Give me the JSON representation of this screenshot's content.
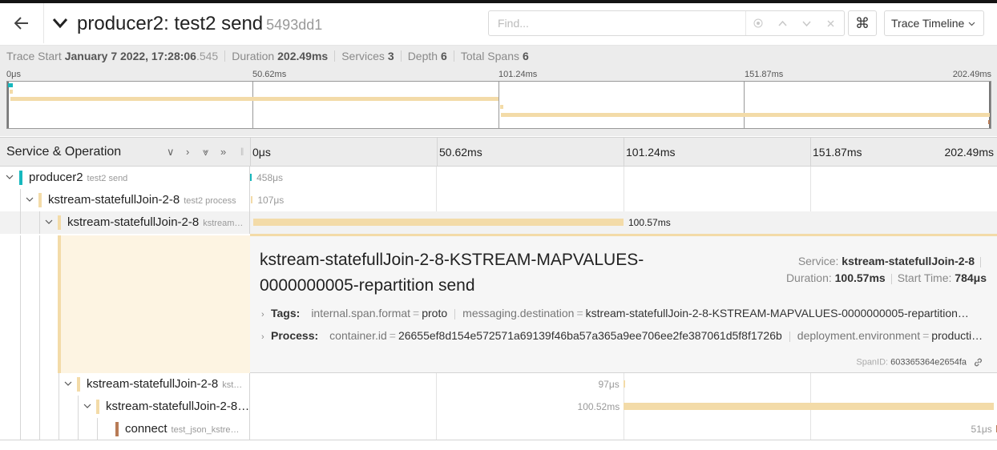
{
  "header": {
    "back_icon": "arrow-left-icon",
    "title": "producer2: test2 send",
    "trace_id": "5493dd1",
    "search": {
      "placeholder": "Find...",
      "value": ""
    },
    "keyboard_icon": "command-key-icon",
    "view_select": "Trace Timeline"
  },
  "summary": {
    "trace_start_label": "Trace Start",
    "trace_start_value": "January 7 2022, 17:28:06",
    "trace_start_ms": ".545",
    "duration_label": "Duration",
    "duration_value": "202.49ms",
    "services_label": "Services",
    "services_value": "3",
    "depth_label": "Depth",
    "depth_value": "6",
    "total_spans_label": "Total Spans",
    "total_spans_value": "6"
  },
  "minimap": {
    "ticks": [
      "0μs",
      "50.62ms",
      "101.24ms",
      "151.87ms",
      "202.49ms"
    ]
  },
  "timeline": {
    "header_label": "Service & Operation",
    "ticks": [
      "0μs",
      "50.62ms",
      "101.24ms",
      "151.87ms",
      "202.49ms"
    ],
    "total_ms": 202.49
  },
  "spans": [
    {
      "service": "producer2",
      "operation": "test2 send",
      "start_ms": 0,
      "duration_ms": 0.458,
      "label": "458μs",
      "color": "#17b8be"
    },
    {
      "service": "kstream-statefullJoin-2-8",
      "operation": "test2 process",
      "start_ms": 0.3,
      "duration_ms": 0.107,
      "label": "107μs",
      "color": "#f3dba8"
    },
    {
      "service": "kstream-statefullJoin-2-8",
      "operation": "kstream…",
      "start_ms": 0.784,
      "duration_ms": 100.57,
      "label": "100.57ms",
      "color": "#f3dba8"
    },
    {
      "service": "kstream-statefullJoin-2-8",
      "operation": "kst…",
      "start_ms": 101.3,
      "duration_ms": 0.097,
      "label": "97μs",
      "color": "#f3dba8"
    },
    {
      "service": "kstream-statefullJoin-2-8…",
      "operation": "",
      "start_ms": 101.4,
      "duration_ms": 100.52,
      "label": "100.52ms",
      "color": "#f3dba8"
    },
    {
      "service": "connect",
      "operation": "test_json_kstre…",
      "start_ms": 202.44,
      "duration_ms": 0.051,
      "label": "51μs",
      "color": "#b87b56"
    }
  ],
  "detail": {
    "title": "kstream-statefullJoin-2-8-KSTREAM-MAPVALUES-0000000005-repartition send",
    "service_label": "Service:",
    "service_value": "kstream-statefullJoin-2-8",
    "duration_label": "Duration:",
    "duration_value": "100.57ms",
    "start_label": "Start Time:",
    "start_value": "784μs",
    "tags_label": "Tags:",
    "tags": [
      {
        "key": "internal.span.format",
        "value": "proto"
      },
      {
        "key": "messaging.destination",
        "value": "kstream-statefullJoin-2-8-KSTREAM-MAPVALUES-0000000005-repartition…"
      }
    ],
    "process_label": "Process:",
    "process": [
      {
        "key": "container.id",
        "value": "26655ef8d154e572571a69139f46ba57a365a9ee706ee2fe387061d5f8f1726b"
      },
      {
        "key": "deployment.environment",
        "value": "producti…"
      }
    ],
    "span_id_label": "SpanID:",
    "span_id": "603365364e2654fa",
    "link_icon": "link-icon"
  }
}
